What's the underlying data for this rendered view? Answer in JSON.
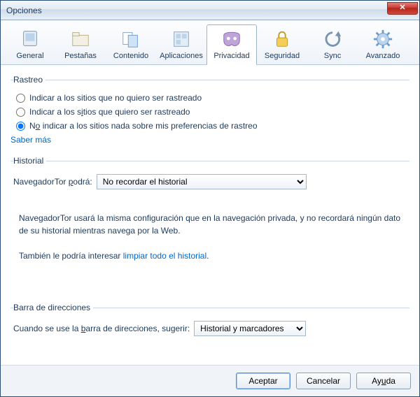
{
  "window": {
    "title": "Opciones"
  },
  "tabs": {
    "general": "General",
    "pestanas": "Pestañas",
    "contenido": "Contenido",
    "aplicaciones": "Aplicaciones",
    "privacidad": "Privacidad",
    "seguridad": "Seguridad",
    "sync": "Sync",
    "avanzado": "Avanzado"
  },
  "rastreo": {
    "legend": "Rastreo",
    "opt1": "Indicar a los sitios que no quiero ser rastreado",
    "opt2": "Indicar a los sitios que quiero ser rastreado",
    "opt3": "No indicar a los sitios nada sobre mis preferencias de rastreo",
    "learn_more": "Saber más"
  },
  "historial": {
    "legend": "Historial",
    "label_prefix": "NavegadorTor ",
    "label_underlined": "p",
    "label_suffix": "odrá:",
    "select_value": "No recordar el historial",
    "desc_line1": "NavegadorTor usará la misma configuración que en la navegación privada, y no recordará ningún dato de su historial mientras navega por la Web.",
    "desc_line2_prefix": "También le podría interesar ",
    "desc_line2_link": "limpiar todo el historial",
    "desc_line2_suffix": "."
  },
  "barra": {
    "legend": "Barra de direcciones",
    "label_prefix": "Cuando se use la ",
    "label_underlined": "b",
    "label_suffix": "arra de direcciones, sugerir:",
    "select_value": "Historial y marcadores"
  },
  "buttons": {
    "accept": "Aceptar",
    "cancel": "Cancelar",
    "help": "Ayuda"
  }
}
